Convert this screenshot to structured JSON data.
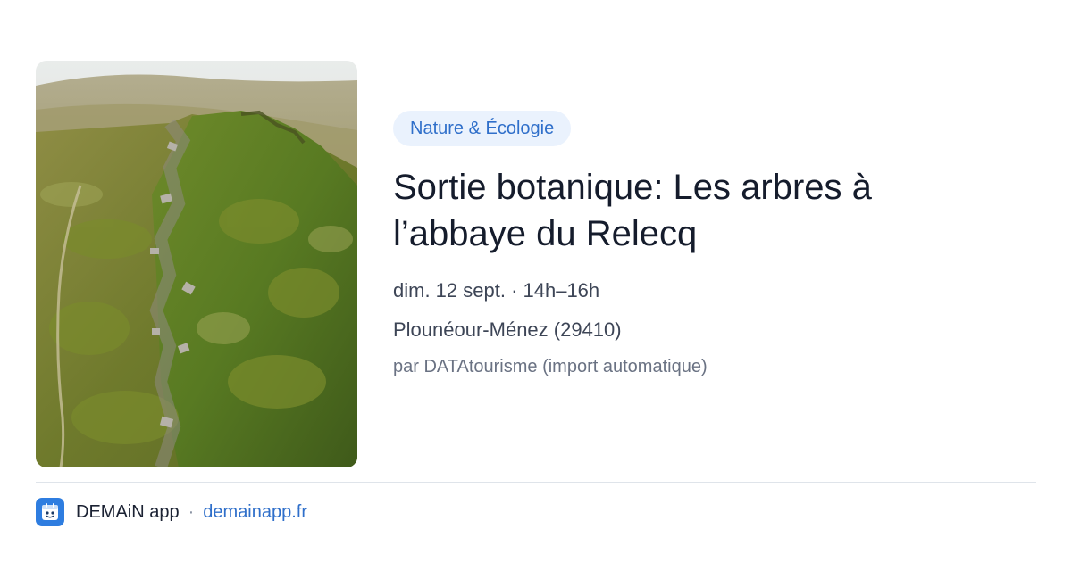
{
  "card": {
    "category": "Nature & Écologie",
    "title": "Sortie botanique: Les arbres à l’abbaye du Relecq",
    "datetime": "dim. 12 sept. · 14h–16h",
    "location": "Plounéour-Ménez (29410)",
    "source": "par DATAtourisme (import automatique)",
    "image_alt": "Aerial view of a rocky moorland ridge covered in green vegetation"
  },
  "footer": {
    "brand": "DEMAiN app",
    "separator": "·",
    "site": "demainapp.fr",
    "logo_icon": "calendar-face-icon"
  },
  "colors": {
    "accent": "#2f6fca",
    "badge_bg": "#eaf2fd",
    "logo_bg": "#2e7de0"
  }
}
